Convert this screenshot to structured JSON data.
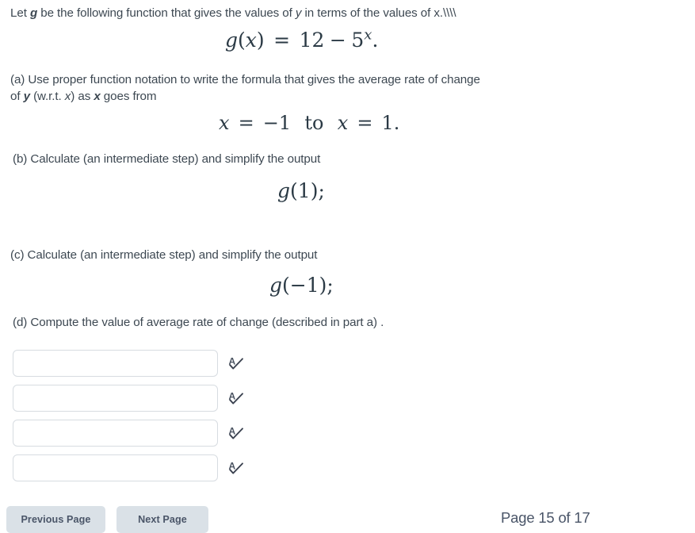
{
  "problem": {
    "intro": {
      "before_g": "Let ",
      "g_symbol": "g",
      "after_g": " be the following function that gives the values of ",
      "y_symbol": "y",
      "middle": " in terms of the values of x.\\\\\\\\"
    },
    "formula": {
      "fn": "g",
      "open": "(",
      "var": "x",
      "close": ")",
      "equals": "=",
      "constant": "12",
      "minus": "−",
      "base": "5",
      "exponent": "x",
      "period": "."
    },
    "parts": [
      {
        "id": "a",
        "label": "(a)",
        "line1": "Use proper function notation to write the formula that gives the average rate of change",
        "line2_pre": "of ",
        "line2_y": "y",
        "line2_mid": " (w.r.t. ",
        "line2_x1": "x",
        "line2_mid2": ")  as  ",
        "line2_x2": "x",
        "line2_post": " goes from"
      },
      {
        "id": "b",
        "label": "(b)",
        "line1": "Calculate (an intermediate step) and simplify the output"
      },
      {
        "id": "c",
        "label": "(c)",
        "line1": "Calculate (an intermediate step) and simplify the output"
      },
      {
        "id": "d",
        "label": "(d)",
        "line1": "Compute the value of average rate of change (described in part a) ."
      }
    ],
    "interval_math": {
      "var1": "x",
      "eq1": "=",
      "val1": "−1",
      "to": "to",
      "var2": "x",
      "eq2": "=",
      "val2": "1",
      "period": "."
    },
    "eval_b": {
      "fn": "g",
      "open": "(",
      "arg": "1",
      "close": ")",
      "semicolon": ";"
    },
    "eval_c": {
      "fn": "g",
      "open": "(",
      "arg": "−1",
      "close": ")",
      "semicolon": ";"
    }
  },
  "answers": {
    "placeholder": "",
    "fields": [
      {
        "name": "answer-a",
        "value": ""
      },
      {
        "name": "answer-b",
        "value": ""
      },
      {
        "name": "answer-c",
        "value": ""
      },
      {
        "name": "answer-d",
        "value": ""
      }
    ],
    "preview_icon": "answer-preview-icon"
  },
  "footer": {
    "previous_label": "Previous Page",
    "next_label": "Next Page",
    "page_indicator": "Page 15 of 17",
    "current_page": 15,
    "total_pages": 17
  },
  "colors": {
    "text": "#3d4852",
    "math": "#2b3a45",
    "button_bg": "#dae1e7",
    "button_text": "#4a5568",
    "input_border": "#d7dce1",
    "background": "#ffffff"
  }
}
